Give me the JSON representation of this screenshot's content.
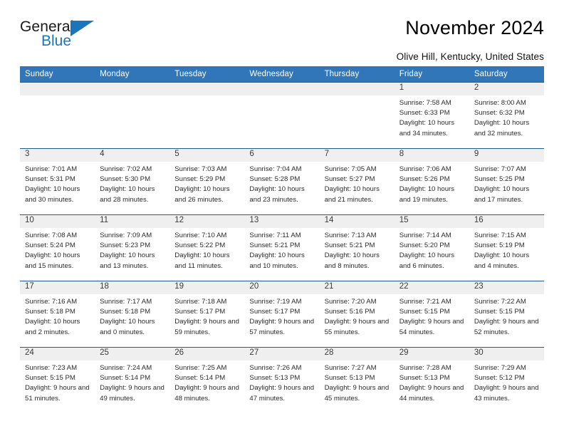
{
  "brand": {
    "name_top": "General",
    "name_bottom": "Blue",
    "accent_color": "#1b75bb",
    "triangle_icon": "brand-triangle-icon"
  },
  "header": {
    "title": "November 2024",
    "location": "Olive Hill, Kentucky, United States"
  },
  "theme": {
    "header_row_bg": "#3076b8",
    "week_separator": "#1f5c96",
    "daynum_strip_bg": "#efefef",
    "page_bg": "#ffffff",
    "text_color": "#2b2b2b"
  },
  "calendar": {
    "day_headers": [
      "Sunday",
      "Monday",
      "Tuesday",
      "Wednesday",
      "Thursday",
      "Friday",
      "Saturday"
    ],
    "labels": {
      "sunrise_prefix": "Sunrise:",
      "sunset_prefix": "Sunset:",
      "daylight_prefix": "Daylight:"
    },
    "weeks": [
      [
        {
          "day": "",
          "empty": true
        },
        {
          "day": "",
          "empty": true
        },
        {
          "day": "",
          "empty": true
        },
        {
          "day": "",
          "empty": true
        },
        {
          "day": "",
          "empty": true
        },
        {
          "day": "1",
          "sunrise": "Sunrise: 7:58 AM",
          "sunset": "Sunset: 6:33 PM",
          "daylight": "Daylight: 10 hours and 34 minutes."
        },
        {
          "day": "2",
          "sunrise": "Sunrise: 8:00 AM",
          "sunset": "Sunset: 6:32 PM",
          "daylight": "Daylight: 10 hours and 32 minutes."
        }
      ],
      [
        {
          "day": "3",
          "sunrise": "Sunrise: 7:01 AM",
          "sunset": "Sunset: 5:31 PM",
          "daylight": "Daylight: 10 hours and 30 minutes."
        },
        {
          "day": "4",
          "sunrise": "Sunrise: 7:02 AM",
          "sunset": "Sunset: 5:30 PM",
          "daylight": "Daylight: 10 hours and 28 minutes."
        },
        {
          "day": "5",
          "sunrise": "Sunrise: 7:03 AM",
          "sunset": "Sunset: 5:29 PM",
          "daylight": "Daylight: 10 hours and 26 minutes."
        },
        {
          "day": "6",
          "sunrise": "Sunrise: 7:04 AM",
          "sunset": "Sunset: 5:28 PM",
          "daylight": "Daylight: 10 hours and 23 minutes."
        },
        {
          "day": "7",
          "sunrise": "Sunrise: 7:05 AM",
          "sunset": "Sunset: 5:27 PM",
          "daylight": "Daylight: 10 hours and 21 minutes."
        },
        {
          "day": "8",
          "sunrise": "Sunrise: 7:06 AM",
          "sunset": "Sunset: 5:26 PM",
          "daylight": "Daylight: 10 hours and 19 minutes."
        },
        {
          "day": "9",
          "sunrise": "Sunrise: 7:07 AM",
          "sunset": "Sunset: 5:25 PM",
          "daylight": "Daylight: 10 hours and 17 minutes."
        }
      ],
      [
        {
          "day": "10",
          "sunrise": "Sunrise: 7:08 AM",
          "sunset": "Sunset: 5:24 PM",
          "daylight": "Daylight: 10 hours and 15 minutes."
        },
        {
          "day": "11",
          "sunrise": "Sunrise: 7:09 AM",
          "sunset": "Sunset: 5:23 PM",
          "daylight": "Daylight: 10 hours and 13 minutes."
        },
        {
          "day": "12",
          "sunrise": "Sunrise: 7:10 AM",
          "sunset": "Sunset: 5:22 PM",
          "daylight": "Daylight: 10 hours and 11 minutes."
        },
        {
          "day": "13",
          "sunrise": "Sunrise: 7:11 AM",
          "sunset": "Sunset: 5:21 PM",
          "daylight": "Daylight: 10 hours and 10 minutes."
        },
        {
          "day": "14",
          "sunrise": "Sunrise: 7:13 AM",
          "sunset": "Sunset: 5:21 PM",
          "daylight": "Daylight: 10 hours and 8 minutes."
        },
        {
          "day": "15",
          "sunrise": "Sunrise: 7:14 AM",
          "sunset": "Sunset: 5:20 PM",
          "daylight": "Daylight: 10 hours and 6 minutes."
        },
        {
          "day": "16",
          "sunrise": "Sunrise: 7:15 AM",
          "sunset": "Sunset: 5:19 PM",
          "daylight": "Daylight: 10 hours and 4 minutes."
        }
      ],
      [
        {
          "day": "17",
          "sunrise": "Sunrise: 7:16 AM",
          "sunset": "Sunset: 5:18 PM",
          "daylight": "Daylight: 10 hours and 2 minutes."
        },
        {
          "day": "18",
          "sunrise": "Sunrise: 7:17 AM",
          "sunset": "Sunset: 5:18 PM",
          "daylight": "Daylight: 10 hours and 0 minutes."
        },
        {
          "day": "19",
          "sunrise": "Sunrise: 7:18 AM",
          "sunset": "Sunset: 5:17 PM",
          "daylight": "Daylight: 9 hours and 59 minutes."
        },
        {
          "day": "20",
          "sunrise": "Sunrise: 7:19 AM",
          "sunset": "Sunset: 5:17 PM",
          "daylight": "Daylight: 9 hours and 57 minutes."
        },
        {
          "day": "21",
          "sunrise": "Sunrise: 7:20 AM",
          "sunset": "Sunset: 5:16 PM",
          "daylight": "Daylight: 9 hours and 55 minutes."
        },
        {
          "day": "22",
          "sunrise": "Sunrise: 7:21 AM",
          "sunset": "Sunset: 5:15 PM",
          "daylight": "Daylight: 9 hours and 54 minutes."
        },
        {
          "day": "23",
          "sunrise": "Sunrise: 7:22 AM",
          "sunset": "Sunset: 5:15 PM",
          "daylight": "Daylight: 9 hours and 52 minutes."
        }
      ],
      [
        {
          "day": "24",
          "sunrise": "Sunrise: 7:23 AM",
          "sunset": "Sunset: 5:15 PM",
          "daylight": "Daylight: 9 hours and 51 minutes."
        },
        {
          "day": "25",
          "sunrise": "Sunrise: 7:24 AM",
          "sunset": "Sunset: 5:14 PM",
          "daylight": "Daylight: 9 hours and 49 minutes."
        },
        {
          "day": "26",
          "sunrise": "Sunrise: 7:25 AM",
          "sunset": "Sunset: 5:14 PM",
          "daylight": "Daylight: 9 hours and 48 minutes."
        },
        {
          "day": "27",
          "sunrise": "Sunrise: 7:26 AM",
          "sunset": "Sunset: 5:13 PM",
          "daylight": "Daylight: 9 hours and 47 minutes."
        },
        {
          "day": "28",
          "sunrise": "Sunrise: 7:27 AM",
          "sunset": "Sunset: 5:13 PM",
          "daylight": "Daylight: 9 hours and 45 minutes."
        },
        {
          "day": "29",
          "sunrise": "Sunrise: 7:28 AM",
          "sunset": "Sunset: 5:13 PM",
          "daylight": "Daylight: 9 hours and 44 minutes."
        },
        {
          "day": "30",
          "sunrise": "Sunrise: 7:29 AM",
          "sunset": "Sunset: 5:12 PM",
          "daylight": "Daylight: 9 hours and 43 minutes."
        }
      ]
    ]
  }
}
